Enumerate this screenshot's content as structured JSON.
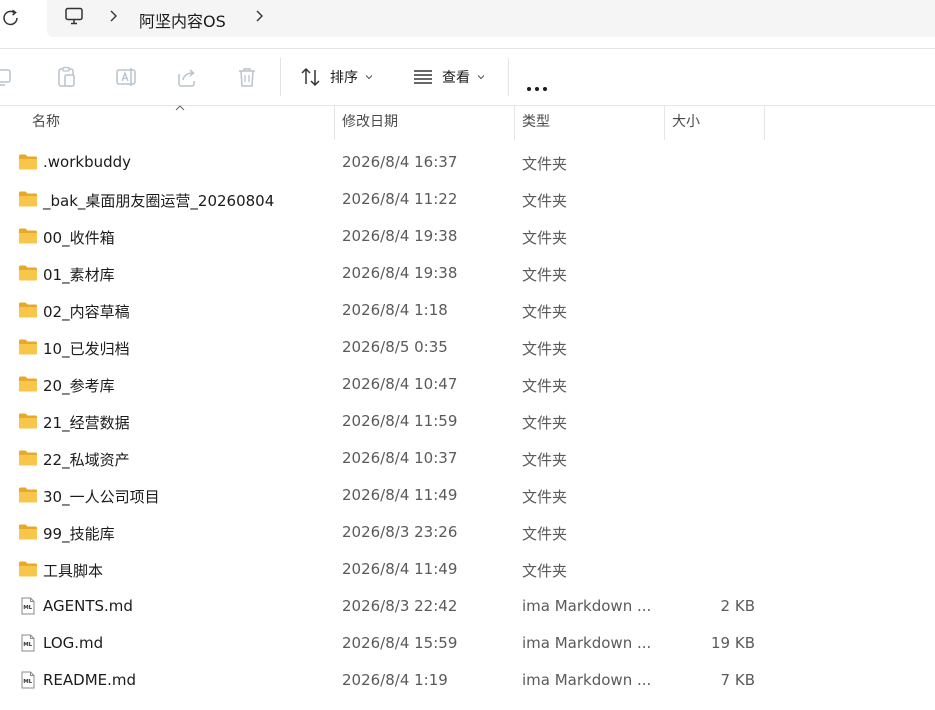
{
  "address": {
    "breadcrumb": "阿坚内容OS",
    "icons": [
      "refresh-icon",
      "this-pc-icon",
      "chevron-right-icon"
    ]
  },
  "toolbar": {
    "icons": [
      "copy-icon",
      "paste-icon",
      "rename-icon",
      "share-icon",
      "delete-icon"
    ],
    "sort_label": "排序",
    "view_label": "查看",
    "more_icon": "more-icon"
  },
  "columns": {
    "name": "名称",
    "modified": "修改日期",
    "type": "类型",
    "size": "大小"
  },
  "files": [
    {
      "name": ".workbuddy",
      "modified": "2026/8/4 16:37",
      "type": "文件夹",
      "size": "",
      "icon": "folder-icon"
    },
    {
      "name": "_bak_桌面朋友圈运营_20260804",
      "modified": "2026/8/4 11:22",
      "type": "文件夹",
      "size": "",
      "icon": "folder-icon"
    },
    {
      "name": "00_收件箱",
      "modified": "2026/8/4 19:38",
      "type": "文件夹",
      "size": "",
      "icon": "folder-icon"
    },
    {
      "name": "01_素材库",
      "modified": "2026/8/4 19:38",
      "type": "文件夹",
      "size": "",
      "icon": "folder-icon"
    },
    {
      "name": "02_内容草稿",
      "modified": "2026/8/4 1:18",
      "type": "文件夹",
      "size": "",
      "icon": "folder-icon"
    },
    {
      "name": "10_已发归档",
      "modified": "2026/8/5 0:35",
      "type": "文件夹",
      "size": "",
      "icon": "folder-icon"
    },
    {
      "name": "20_参考库",
      "modified": "2026/8/4 10:47",
      "type": "文件夹",
      "size": "",
      "icon": "folder-icon"
    },
    {
      "name": "21_经营数据",
      "modified": "2026/8/4 11:59",
      "type": "文件夹",
      "size": "",
      "icon": "folder-icon"
    },
    {
      "name": "22_私域资产",
      "modified": "2026/8/4 10:37",
      "type": "文件夹",
      "size": "",
      "icon": "folder-icon"
    },
    {
      "name": "30_一人公司项目",
      "modified": "2026/8/4 11:49",
      "type": "文件夹",
      "size": "",
      "icon": "folder-icon"
    },
    {
      "name": "99_技能库",
      "modified": "2026/8/3 23:26",
      "type": "文件夹",
      "size": "",
      "icon": "folder-icon"
    },
    {
      "name": "工具脚本",
      "modified": "2026/8/4 11:49",
      "type": "文件夹",
      "size": "",
      "icon": "folder-icon"
    },
    {
      "name": "AGENTS.md",
      "modified": "2026/8/3 22:42",
      "type": "ima Markdown ...",
      "size": "2 KB",
      "icon": "markdown-file-icon"
    },
    {
      "name": "LOG.md",
      "modified": "2026/8/4 15:59",
      "type": "ima Markdown ...",
      "size": "19 KB",
      "icon": "markdown-file-icon"
    },
    {
      "name": "README.md",
      "modified": "2026/8/4 1:19",
      "type": "ima Markdown ...",
      "size": "7 KB",
      "icon": "markdown-file-icon"
    }
  ],
  "colors": {
    "folder": "#f8c64a",
    "folder_dark": "#e8a92b",
    "text": "#1b1b1b",
    "muted": "#5a5a5a",
    "disabled_icon": "#b9c3cc"
  }
}
